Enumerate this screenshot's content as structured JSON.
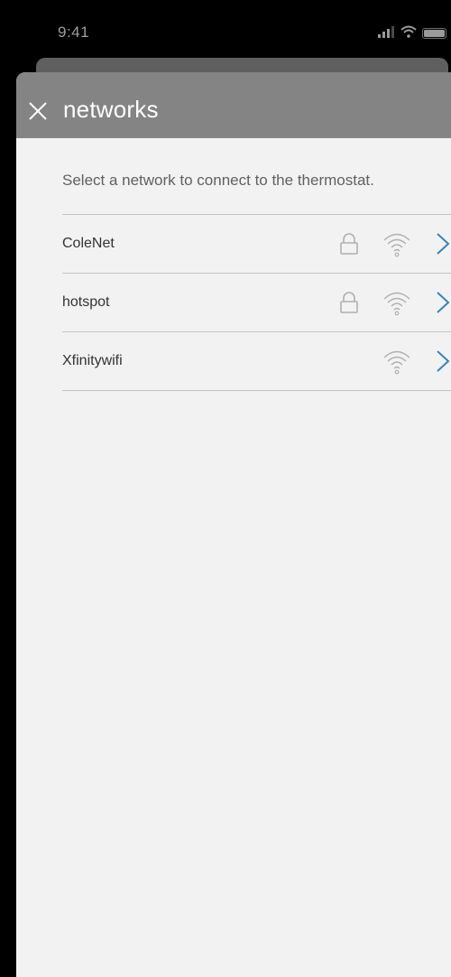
{
  "status_bar": {
    "time": "9:41",
    "icons": [
      "signal-icon",
      "wifi-status-icon",
      "battery-icon"
    ]
  },
  "header": {
    "close_icon": "close-icon",
    "title": "networks"
  },
  "instructions": "Select a network to connect to the thermostat.",
  "networks": [
    {
      "name": "ColeNet",
      "secured": true,
      "icons": [
        "lock-icon",
        "wifi-icon",
        "chevron-right-icon"
      ]
    },
    {
      "name": "hotspot",
      "secured": true,
      "icons": [
        "lock-icon",
        "wifi-icon",
        "chevron-right-icon"
      ]
    },
    {
      "name": "Xfinitywifi",
      "secured": false,
      "icons": [
        "wifi-icon",
        "chevron-right-icon"
      ]
    }
  ],
  "colors": {
    "header_background": "#848484",
    "sheet_background": "#f2f2f2",
    "accent_chevron": "#3b82b8",
    "icon_gray": "#b0b0b0"
  }
}
